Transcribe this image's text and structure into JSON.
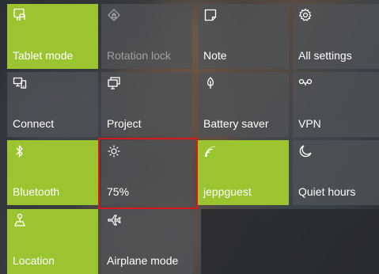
{
  "tiles": {
    "tablet_mode": {
      "label": "Tablet mode",
      "state": "on",
      "icon": "tablet-mode-icon"
    },
    "rotation_lock": {
      "label": "Rotation lock",
      "state": "disabled",
      "icon": "rotation-lock-icon"
    },
    "note": {
      "label": "Note",
      "state": "off",
      "icon": "note-icon"
    },
    "all_settings": {
      "label": "All settings",
      "state": "off",
      "icon": "gear-icon"
    },
    "connect": {
      "label": "Connect",
      "state": "off",
      "icon": "connect-icon"
    },
    "project": {
      "label": "Project",
      "state": "off",
      "icon": "project-icon"
    },
    "battery_saver": {
      "label": "Battery saver",
      "state": "off",
      "icon": "battery-saver-icon"
    },
    "vpn": {
      "label": "VPN",
      "state": "off",
      "icon": "vpn-icon"
    },
    "bluetooth": {
      "label": "Bluetooth",
      "state": "on",
      "icon": "bluetooth-icon"
    },
    "brightness": {
      "label": "75%",
      "state": "off",
      "icon": "brightness-icon",
      "level": 75
    },
    "wifi": {
      "label": "jeppguest",
      "state": "on",
      "icon": "wifi-icon"
    },
    "quiet_hours": {
      "label": "Quiet hours",
      "state": "off",
      "icon": "moon-icon"
    },
    "location": {
      "label": "Location",
      "state": "on",
      "icon": "location-icon"
    },
    "airplane_mode": {
      "label": "Airplane mode",
      "state": "off",
      "icon": "airplane-icon"
    }
  },
  "colors": {
    "accent_on": "#9bc530",
    "tile_off": "#505256",
    "highlight": "#d6191d"
  }
}
